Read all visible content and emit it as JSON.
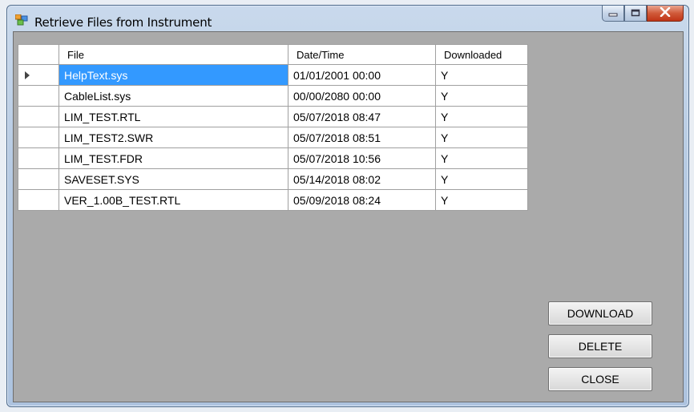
{
  "window": {
    "title": "Retrieve Files from Instrument"
  },
  "grid": {
    "columns": [
      "File",
      "Date/Time",
      "Downloaded"
    ],
    "rows": [
      {
        "file": "HelpText.sys",
        "datetime": "01/01/2001 00:00",
        "downloaded": "Y"
      },
      {
        "file": "CableList.sys",
        "datetime": "00/00/2080 00:00",
        "downloaded": "Y"
      },
      {
        "file": "LIM_TEST.RTL",
        "datetime": "05/07/2018 08:47",
        "downloaded": "Y"
      },
      {
        "file": "LIM_TEST2.SWR",
        "datetime": "05/07/2018 08:51",
        "downloaded": "Y"
      },
      {
        "file": "LIM_TEST.FDR",
        "datetime": "05/07/2018 10:56",
        "downloaded": "Y"
      },
      {
        "file": "SAVESET.SYS",
        "datetime": "05/14/2018 08:02",
        "downloaded": "Y"
      },
      {
        "file": "VER_1.00B_TEST.RTL",
        "datetime": "05/09/2018 08:24",
        "downloaded": "Y"
      }
    ]
  },
  "buttons": {
    "download": "DOWNLOAD",
    "delete": "DELETE",
    "close": "CLOSE"
  },
  "colors": {
    "selection": "#3399ff",
    "client_background": "#aaaaaa"
  },
  "icons": {
    "app": "app-window-icon",
    "row_indicator": "current-row-arrow-icon"
  }
}
